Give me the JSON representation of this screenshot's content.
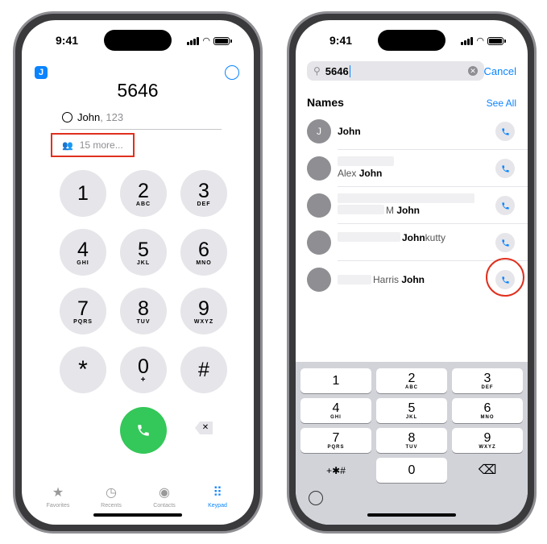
{
  "left": {
    "time": "9:41",
    "avatar_letter": "J",
    "dialed_number": "5646",
    "match": {
      "name": "John",
      "sub": ", 123"
    },
    "more": "15 more...",
    "keys": [
      {
        "d": "1",
        "l": ""
      },
      {
        "d": "2",
        "l": "ABC"
      },
      {
        "d": "3",
        "l": "DEF"
      },
      {
        "d": "4",
        "l": "GHI"
      },
      {
        "d": "5",
        "l": "JKL"
      },
      {
        "d": "6",
        "l": "MNO"
      },
      {
        "d": "7",
        "l": "PQRS"
      },
      {
        "d": "8",
        "l": "TUV"
      },
      {
        "d": "9",
        "l": "WXYZ"
      },
      {
        "d": "*",
        "l": ""
      },
      {
        "d": "0",
        "l": "+"
      },
      {
        "d": "#",
        "l": ""
      }
    ],
    "delete_glyph": "✕",
    "tabs": [
      {
        "label": "Favorites",
        "icon": "star-icon",
        "glyph": "★"
      },
      {
        "label": "Recents",
        "icon": "clock-icon",
        "glyph": "◷"
      },
      {
        "label": "Contacts",
        "icon": "person-circle-icon",
        "glyph": "◉"
      },
      {
        "label": "Keypad",
        "icon": "keypad-icon",
        "glyph": "⠿"
      }
    ]
  },
  "right": {
    "time": "9:41",
    "search_value": "5646",
    "cancel": "Cancel",
    "section": "Names",
    "see_all": "See All",
    "results": [
      {
        "initial": "J",
        "pre": "",
        "bold": "John",
        "post": ""
      },
      {
        "initial": "",
        "pre": "Alex ",
        "bold": "John",
        "post": ""
      },
      {
        "initial": "",
        "pre": "M ",
        "bold": "John",
        "post": ""
      },
      {
        "initial": "",
        "pre": "",
        "bold": "John",
        "post": "kutty"
      },
      {
        "initial": "",
        "pre": "Harris ",
        "bold": "John",
        "post": ""
      }
    ],
    "keys": [
      {
        "d": "1",
        "l": ""
      },
      {
        "d": "2",
        "l": "ABC"
      },
      {
        "d": "3",
        "l": "DEF"
      },
      {
        "d": "4",
        "l": "GHI"
      },
      {
        "d": "5",
        "l": "JKL"
      },
      {
        "d": "6",
        "l": "MNO"
      },
      {
        "d": "7",
        "l": "PQRS"
      },
      {
        "d": "8",
        "l": "TUV"
      },
      {
        "d": "9",
        "l": "WXYZ"
      },
      {
        "d": "+✱#",
        "l": ""
      },
      {
        "d": "0",
        "l": ""
      },
      {
        "d": "⌫",
        "l": ""
      }
    ]
  },
  "colors": {
    "accent": "#0a84ff",
    "call_green": "#34c759",
    "highlight_red": "#e0301e"
  }
}
